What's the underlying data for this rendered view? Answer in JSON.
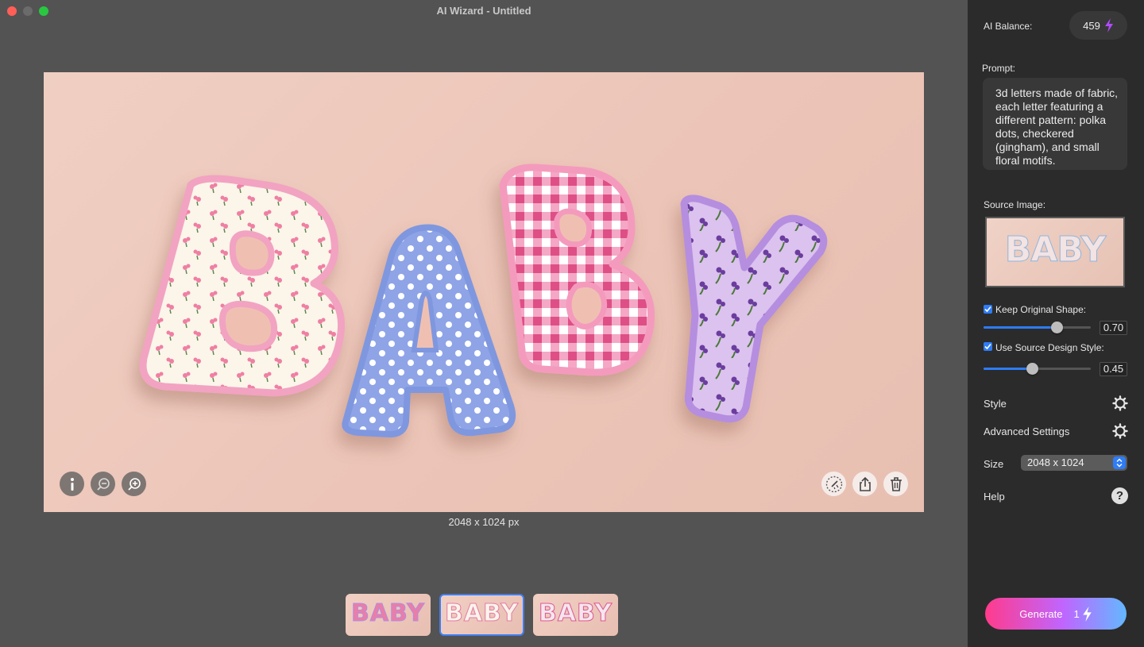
{
  "window": {
    "title": "AI Wizard - Untitled"
  },
  "canvas": {
    "letters": [
      "B",
      "A",
      "B",
      "Y"
    ],
    "image_size": "2048 x 1024 px",
    "tools_left": [
      "info-icon",
      "zoom-out-icon",
      "zoom-in-icon"
    ],
    "tools_right": [
      "magic-cut-icon",
      "share-icon",
      "trash-icon"
    ]
  },
  "thumbnails": [
    {
      "text": "BABY",
      "selected": false
    },
    {
      "text": "BABY",
      "selected": true
    },
    {
      "text": "BABY",
      "selected": false
    }
  ],
  "sidebar": {
    "balance_label": "AI Balance:",
    "balance_value": "459",
    "prompt_label": "Prompt:",
    "prompt_text": "3d letters made of fabric, each letter featuring a different pattern: polka dots, checkered (gingham), and small floral motifs.",
    "source_label": "Source Image:",
    "source_text": "BABY",
    "keep_shape": {
      "label": "Keep Original Shape:",
      "checked": true,
      "value": "0.70",
      "level": 0.7
    },
    "design_style": {
      "label": "Use Source Design Style:",
      "checked": true,
      "value": "0.45",
      "level": 0.45
    },
    "style_label": "Style",
    "advanced_label": "Advanced Settings",
    "size_label": "Size",
    "size_value": "2048 x 1024",
    "help_label": "Help",
    "generate_label": "Generate",
    "generate_cost": "1"
  },
  "colors": {
    "accent": "#2e7cf6",
    "bolt": "#b14bff",
    "letter_b1": "#fbf4ea",
    "letter_a": "#8ea3e6",
    "letter_b2": "#e8568f",
    "letter_y": "#d9b9ec"
  }
}
